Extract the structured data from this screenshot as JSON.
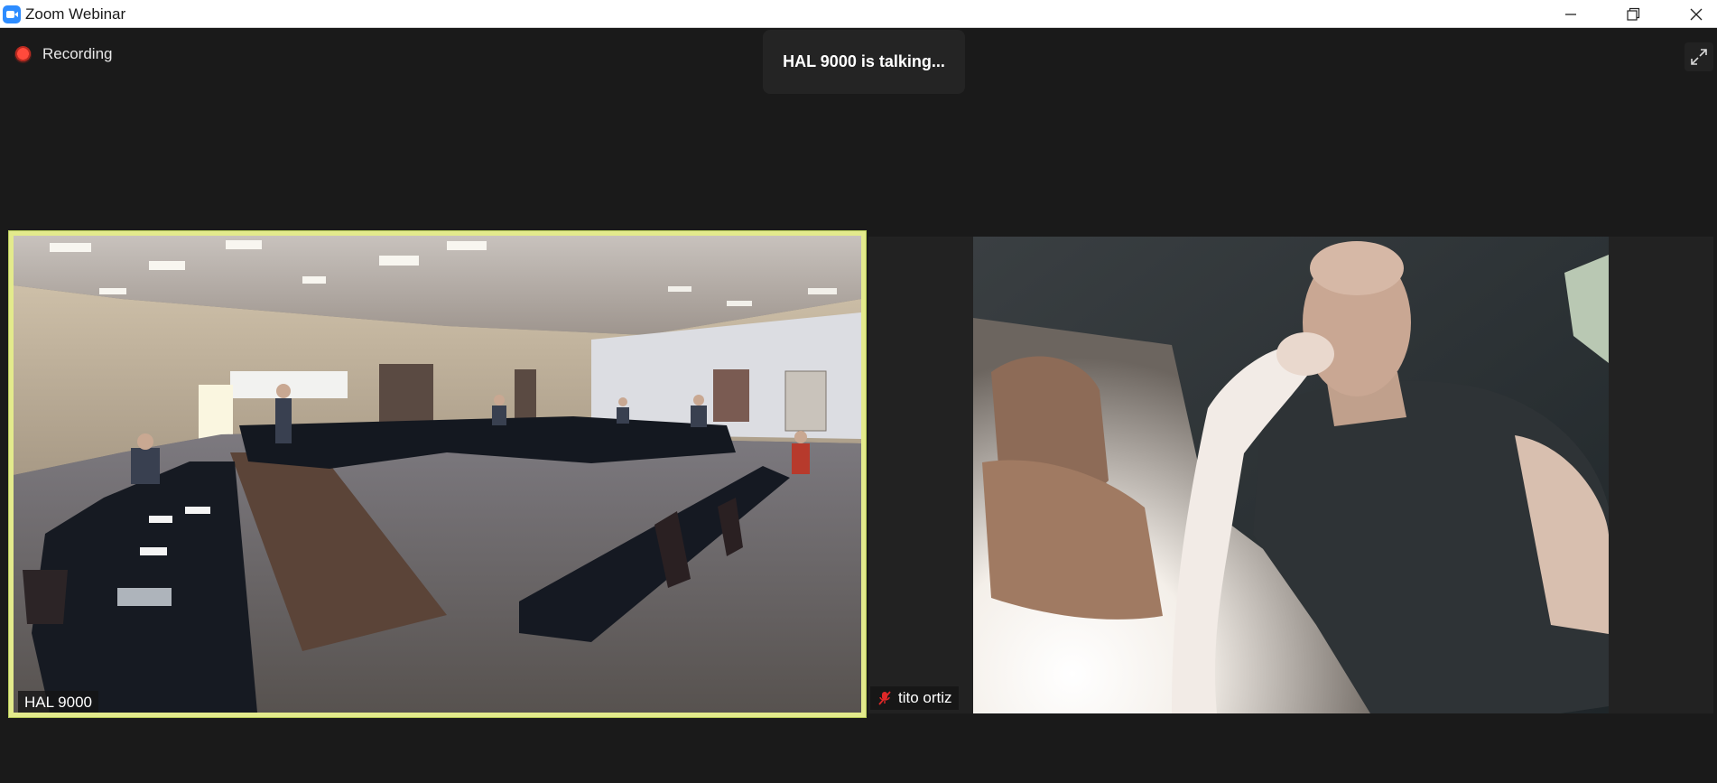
{
  "window": {
    "title": "Zoom Webinar",
    "icons": [
      "zoom-app-icon",
      "minimize-icon",
      "restore-icon",
      "close-icon"
    ]
  },
  "status": {
    "recording_label": "Recording",
    "talking_text": "HAL 9000 is talking..."
  },
  "participants": [
    {
      "name": "HAL 9000",
      "active_speaker": true,
      "muted": false,
      "video": "conference room with U-shaped tables"
    },
    {
      "name": "tito ortiz",
      "active_speaker": false,
      "muted": true,
      "video": "man in a car"
    }
  ],
  "colors": {
    "background": "#1a1a1a",
    "active_speaker_border": "#e3ea8c",
    "recording_red": "#ff4a3c",
    "mute_red": "#e02828",
    "accent": "#2d8cff"
  }
}
